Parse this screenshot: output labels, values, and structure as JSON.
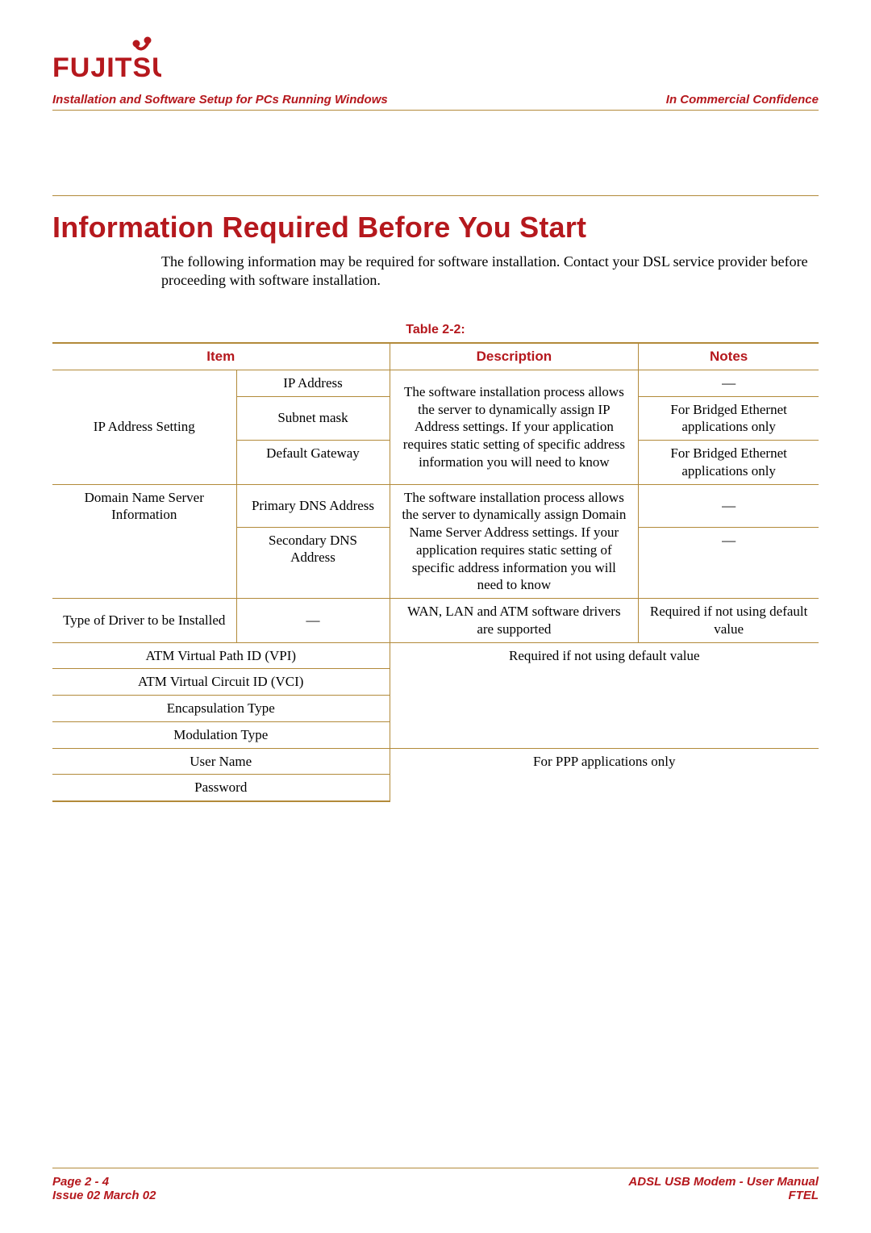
{
  "brand": "FUJITSU",
  "header": {
    "left": "Installation and Software Setup for PCs Running Windows",
    "right": "In Commercial Confidence"
  },
  "title": "Information Required Before You Start",
  "intro": "The following information may be required for software installation. Contact your DSL service provider before proceeding with software installation.",
  "table": {
    "caption": "Table 2-2:",
    "headers": {
      "item": "Item",
      "description": "Description",
      "notes": "Notes"
    },
    "dash": "—",
    "rows": {
      "ip_setting_label": "IP Address Setting",
      "ip_address": "IP Address",
      "subnet_mask": "Subnet mask",
      "default_gateway": "Default Gateway",
      "ip_desc": "The software installation process allows the server to dynamically assign IP Address settings. If your application requires static setting of specific address information you will need to know",
      "bridged_note": "For Bridged Ethernet applications only",
      "dns_label": "Domain Name Server Information",
      "primary_dns": "Primary DNS Address",
      "secondary_dns": "Secondary DNS Address",
      "dns_desc": "The software installation process allows the server to dynamically assign Domain Name Server Address settings. If your application requires static setting of specific address information you will need to know",
      "driver_label": "Type of Driver to be Installed",
      "driver_desc": "WAN, LAN and ATM software drivers are supported",
      "driver_note": "Required if not using default value",
      "vpi": "ATM Virtual Path ID (VPI)",
      "vci": "ATM Virtual Circuit ID (VCI)",
      "encap": "Encapsulation Type",
      "mod": "Modulation Type",
      "req_default": "Required if not using default value",
      "user": "User Name",
      "password": "Password",
      "ppp_only": "For PPP applications only"
    }
  },
  "footer": {
    "page": "Page 2 - 4",
    "issue": "Issue 02 March 02",
    "manual": "ADSL USB Modem - User Manual",
    "org": "FTEL"
  },
  "colors": {
    "brand_red": "#b5181d",
    "rule_gold": "#b28a3a"
  }
}
